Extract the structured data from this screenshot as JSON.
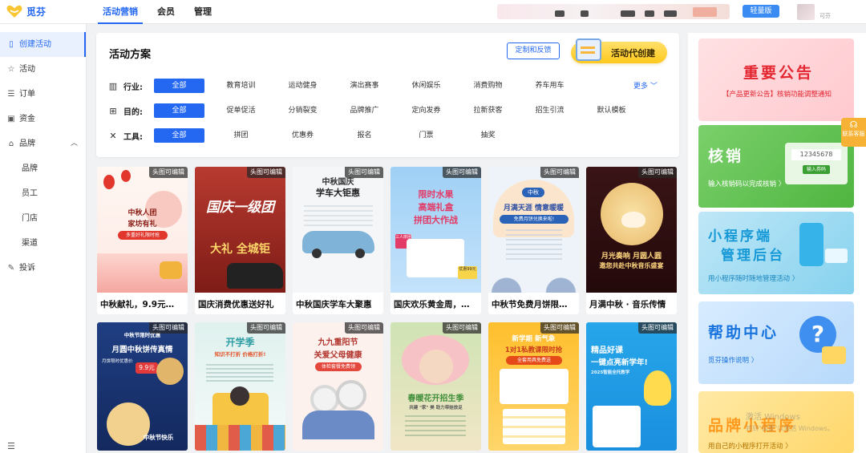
{
  "app": {
    "logo_text": "觅芬"
  },
  "topnav": {
    "tabs": [
      {
        "label": "活动营销",
        "active": true
      },
      {
        "label": "会员"
      },
      {
        "label": "管理"
      }
    ],
    "lite_label": "轻量版",
    "user_name": "可芬"
  },
  "sidebar": {
    "items": [
      {
        "label": "创建活动",
        "icon": "file-icon",
        "active": true
      },
      {
        "label": "活动",
        "icon": "star-icon"
      },
      {
        "label": "订单",
        "icon": "list-icon"
      },
      {
        "label": "资金",
        "icon": "wallet-icon"
      },
      {
        "label": "品牌",
        "icon": "home-icon",
        "expanded": true
      },
      {
        "label": "品牌",
        "sub": true
      },
      {
        "label": "员工",
        "sub": true
      },
      {
        "label": "门店",
        "sub": true
      },
      {
        "label": "渠道",
        "sub": true
      },
      {
        "label": "投诉",
        "icon": "edit-icon"
      }
    ],
    "bottom_icon": "menu-icon"
  },
  "plan": {
    "title": "活动方案",
    "feedback_label": "定制和反馈",
    "proxy_label": "活动代创建",
    "more_label": "更多",
    "rows": [
      {
        "label": "行业:",
        "icon": "building-icon",
        "chips": [
          "全部",
          "教育培训",
          "运动健身",
          "演出赛事",
          "休闲娱乐",
          "消费购物",
          "养车用车"
        ]
      },
      {
        "label": "目的:",
        "icon": "apps-icon",
        "chips": [
          "全部",
          "促单促活",
          "分销裂变",
          "品牌推广",
          "定向发券",
          "拉新获客",
          "招生引流",
          "默认模板"
        ]
      },
      {
        "label": "工具:",
        "icon": "tools-icon",
        "chips": [
          "全部",
          "拼团",
          "优惠券",
          "报名",
          "门票",
          "抽奖"
        ]
      }
    ]
  },
  "cards": {
    "badge": "头图可编辑",
    "row1": [
      {
        "caption": "中秋献礼，9.9元…",
        "poster_lines": [
          "中秋人团",
          "家坊有礼",
          "多重好礼限时抢"
        ]
      },
      {
        "caption": "国庆消费优惠送好礼",
        "poster_lines": [
          "国庆一级团",
          "大礼 全城钜"
        ]
      },
      {
        "caption": "中秋国庆学车大聚惠",
        "poster_lines": [
          "中秋国庆",
          "学车大钜惠"
        ]
      },
      {
        "caption": "国庆欢乐黄金周，…",
        "poster_lines": [
          "限时水果",
          "高端礼盒",
          "拼团大作战",
          "三人拼团",
          "优惠99元"
        ]
      },
      {
        "caption": "中秋节免费月饼限…",
        "poster_lines": [
          "中秋",
          "月满天涯 情意暖暖",
          "免费月饼兑换来啦!"
        ]
      },
      {
        "caption": "月满中秋 · 音乐传情",
        "poster_lines": [
          "月光奏响 月圆人圆",
          "邀您共赴中秋音乐盛宴"
        ]
      }
    ],
    "row2": [
      {
        "poster_lines": [
          "中秋节限时优惠",
          "月圆中秋饼传真情",
          "月饼限时优惠价",
          "9.9元",
          "中秋节快乐"
        ]
      },
      {
        "poster_lines": [
          "开学季",
          "知识不打折 价格打折!"
        ]
      },
      {
        "poster_lines": [
          "九九重阳节",
          "关爱父母健康",
          "体检套餐免费领"
        ]
      },
      {
        "poster_lines": [
          "春暖花开招生季",
          "共建 \"家\" 美 助力带娃放足"
        ]
      },
      {
        "poster_lines": [
          "新学期 新气象",
          "1对1私教课限时抢",
          "全套用具免费送"
        ]
      },
      {
        "poster_lines": [
          "精品好课",
          "一键点亮新学年!",
          "2025智能全托教学"
        ]
      }
    ]
  },
  "promos": [
    {
      "title": "重要公告",
      "sub": "【产品更新公告】核销功能调整通知"
    },
    {
      "title": "核销",
      "sub": "输入核销码以完成核销 〉",
      "code": "12345678",
      "code_btn": "输入券码"
    },
    {
      "title_lines": [
        "小程序端",
        "管理后台"
      ],
      "sub": "用小程序随时随地管理活动 〉"
    },
    {
      "title": "帮助中心",
      "sub": "觅芬操作说明 〉"
    },
    {
      "title": "品牌小程序",
      "sub": "用自己的小程序打开活动 〉"
    }
  ],
  "float": {
    "label": "联系客服"
  },
  "watermark": {
    "line1": "激活 Windows",
    "line2": "转到\"设置\"以激活 Windows。"
  },
  "colors": {
    "accent": "#2468f2",
    "proxy_yellow": "#ffc91d",
    "float_orange": "#f7b235"
  }
}
